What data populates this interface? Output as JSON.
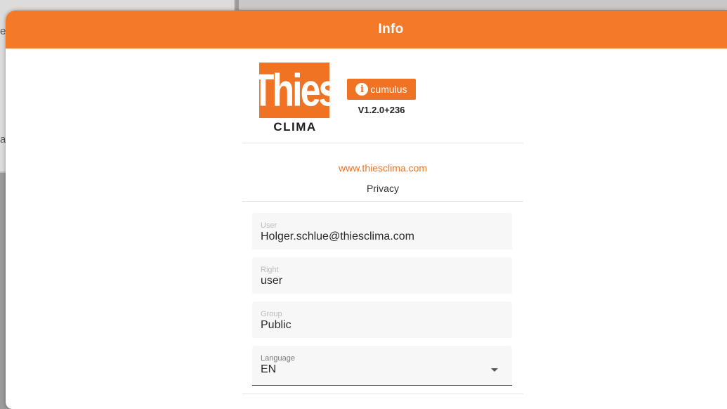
{
  "background": {
    "fragment_1": "e",
    "fragment_2": "a"
  },
  "dialog": {
    "title": "Info",
    "accent_color": "#f47a2a"
  },
  "logo": {
    "word": "Thies",
    "subword": "CLIMA"
  },
  "badge": {
    "icon": "info-icon",
    "icon_glyph": "i",
    "label": "cumulus",
    "version": "V1.2.0+236"
  },
  "links": {
    "website": "www.thiesclima.com",
    "privacy": "Privacy"
  },
  "fields": {
    "user": {
      "label": "User",
      "value": "Holger.schlue@thiesclima.com"
    },
    "right": {
      "label": "Right",
      "value": "user"
    },
    "group": {
      "label": "Group",
      "value": "Public"
    },
    "language": {
      "label": "Language",
      "value": "EN"
    }
  }
}
